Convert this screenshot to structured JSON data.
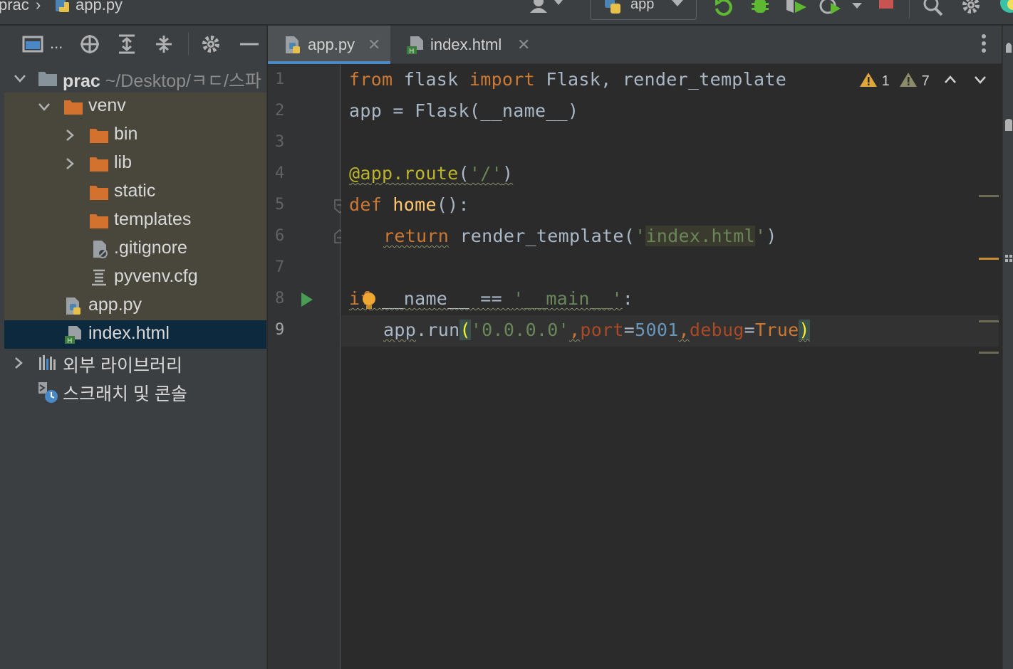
{
  "breadcrumb": {
    "project": "prac",
    "file": "app.py"
  },
  "toolbar": {
    "run_config": "app"
  },
  "project_tree": {
    "root_name": "prac",
    "root_path": "~/Desktop/ㅋㄷ/스파",
    "items": [
      {
        "label": "venv"
      },
      {
        "label": "bin"
      },
      {
        "label": "lib"
      },
      {
        "label": "static"
      },
      {
        "label": "templates"
      },
      {
        "label": ".gitignore"
      },
      {
        "label": "pyvenv.cfg"
      },
      {
        "label": "app.py"
      },
      {
        "label": "index.html"
      }
    ],
    "external_libraries": "외부 라이브러리",
    "scratches": "스크래치 및 콘솔",
    "toolbar_more": "..."
  },
  "tabs": [
    {
      "label": "app.py",
      "active": true
    },
    {
      "label": "index.html",
      "active": false
    }
  ],
  "inspections": {
    "errors": "1",
    "warnings": "7"
  },
  "line_numbers": [
    "1",
    "2",
    "3",
    "4",
    "5",
    "6",
    "7",
    "8",
    "9"
  ],
  "code": {
    "l1": {
      "kw1": "from",
      "mod": " flask ",
      "kw2": "import",
      "rest": " Flask, render_template"
    },
    "l2": {
      "text": "app = Flask(__name__)"
    },
    "l4": {
      "deco": "@app.route",
      "open": "(",
      "str": "'/'",
      "close": ")"
    },
    "l5": {
      "kw": "def",
      "fn": "home",
      "rest": "():"
    },
    "l6": {
      "kw": "return",
      "call": " render_template(",
      "q1": "'",
      "str": "index.html",
      "q2": "'",
      "close": ")"
    },
    "l8": {
      "kw": "if",
      "name": " __name__",
      "op": " == ",
      "str": "'__main__'",
      "colon": ":"
    },
    "l9": {
      "obj": "app",
      "dot": ".run",
      "open": "(",
      "str": "'0.0.0.0'",
      "c1": ",",
      "p1": "port",
      "eq1": "=",
      "num": "5001",
      "c2": ",",
      "p2": "debug",
      "eq2": "=",
      "val": "True",
      "close": ")"
    }
  },
  "colors": {
    "keyword": "#cc7832",
    "function": "#ffc66d",
    "decorator": "#bbb529",
    "string": "#6a8759",
    "number": "#6897bb",
    "param": "#aa4926",
    "selection": "#0d293e",
    "accent": "#4a88c7"
  }
}
